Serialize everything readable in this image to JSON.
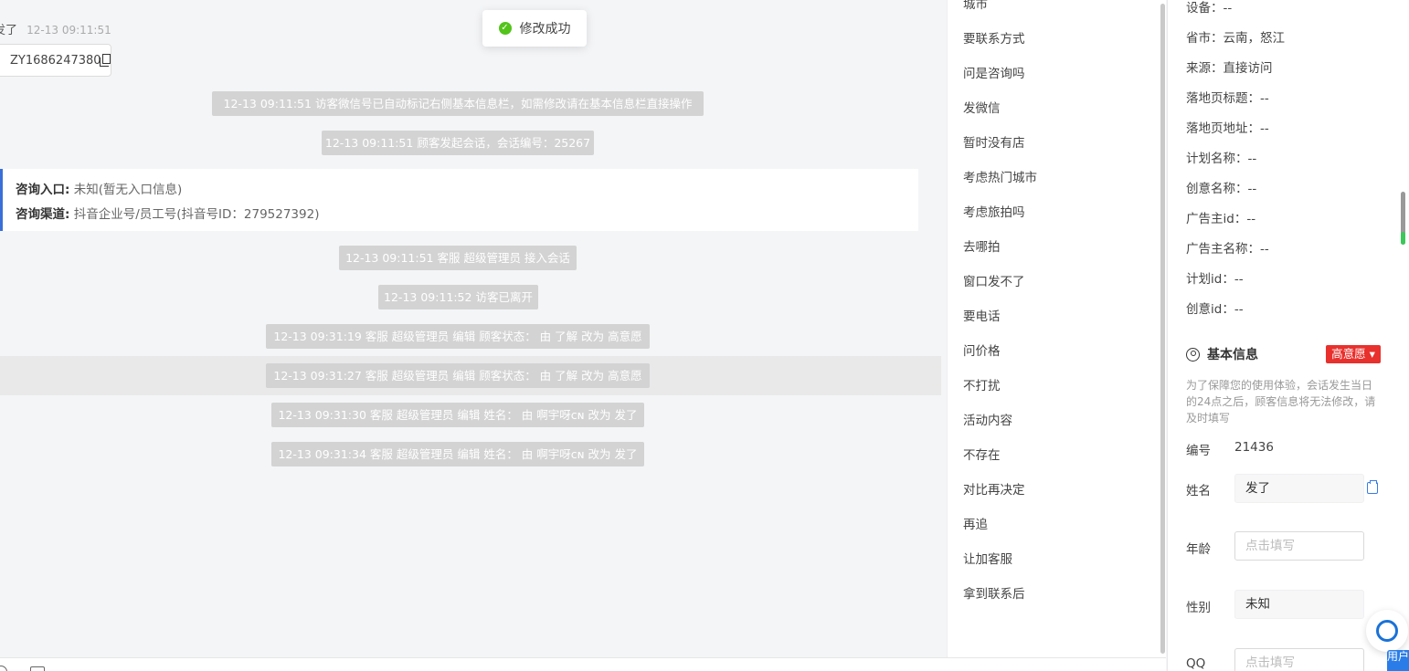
{
  "toast": {
    "text": "修改成功"
  },
  "chat": {
    "header_name": "发了",
    "header_time": "12-13 09:11:51",
    "id_bubble": "ZY1686247380",
    "system_messages": [
      "12-13 09:11:51 访客微信号已自动标记右侧基本信息栏，如需修改请在基本信息栏直接操作",
      "12-13 09:11:51 顾客发起会话，会话编号：25267",
      "12-13 09:11:51 客服 超级管理员 接入会话",
      "12-13 09:11:52 访客已离开",
      "12-13 09:31:19 客服 超级管理员 编辑 顾客状态： 由 了解 改为 高意愿",
      "12-13 09:31:27 客服 超级管理员 编辑 顾客状态： 由 了解 改为 高意愿",
      "12-13 09:31:30 客服 超级管理员 编辑 姓名： 由 啊宇呀ᴄɴ 改为 发了",
      "12-13 09:31:34 客服 超级管理员 编辑 姓名： 由 啊宇呀ᴄɴ 改为 发了"
    ],
    "entry_card": {
      "entry_label": "咨询入口:",
      "entry_value": "未知(暂无入口信息)",
      "channel_label": "咨询渠道:",
      "channel_value": "抖音企业号/员工号(抖音号ID：279527392)"
    }
  },
  "quick_replies": [
    "城市",
    "要联系方式",
    "问是咨询吗",
    "发微信",
    "暂时没有店",
    "考虑热门城市",
    "考虑旅拍吗",
    "去哪拍",
    "窗口发不了",
    "要电话",
    "问价格",
    "不打扰",
    "活动内容",
    "不存在",
    "对比再决定",
    "再追",
    "让加客服",
    "拿到联系后"
  ],
  "info": {
    "rows": [
      "设备：--",
      "省市：云南，怒江",
      "来源：直接访问",
      "落地页标题：--",
      "落地页地址：--",
      "计划名称：--",
      "创意名称：--",
      "广告主id：--",
      "广告主名称：--",
      "计划id：--",
      "创意id：--"
    ],
    "section_title": "基本信息",
    "intent_tag": "高意愿 ▾",
    "notice": "为了保障您的使用体验，会话发生当日的24点之后，顾客信息将无法修改，请及时填写",
    "fields": {
      "id_label": "编号",
      "id_value": "21436",
      "name_label": "姓名",
      "name_value": "发了",
      "age_label": "年龄",
      "age_placeholder": "点击填写",
      "gender_label": "性别",
      "gender_value": "未知",
      "qq_label": "QQ",
      "qq_placeholder": "点击填写"
    }
  },
  "help_tab": "用户"
}
